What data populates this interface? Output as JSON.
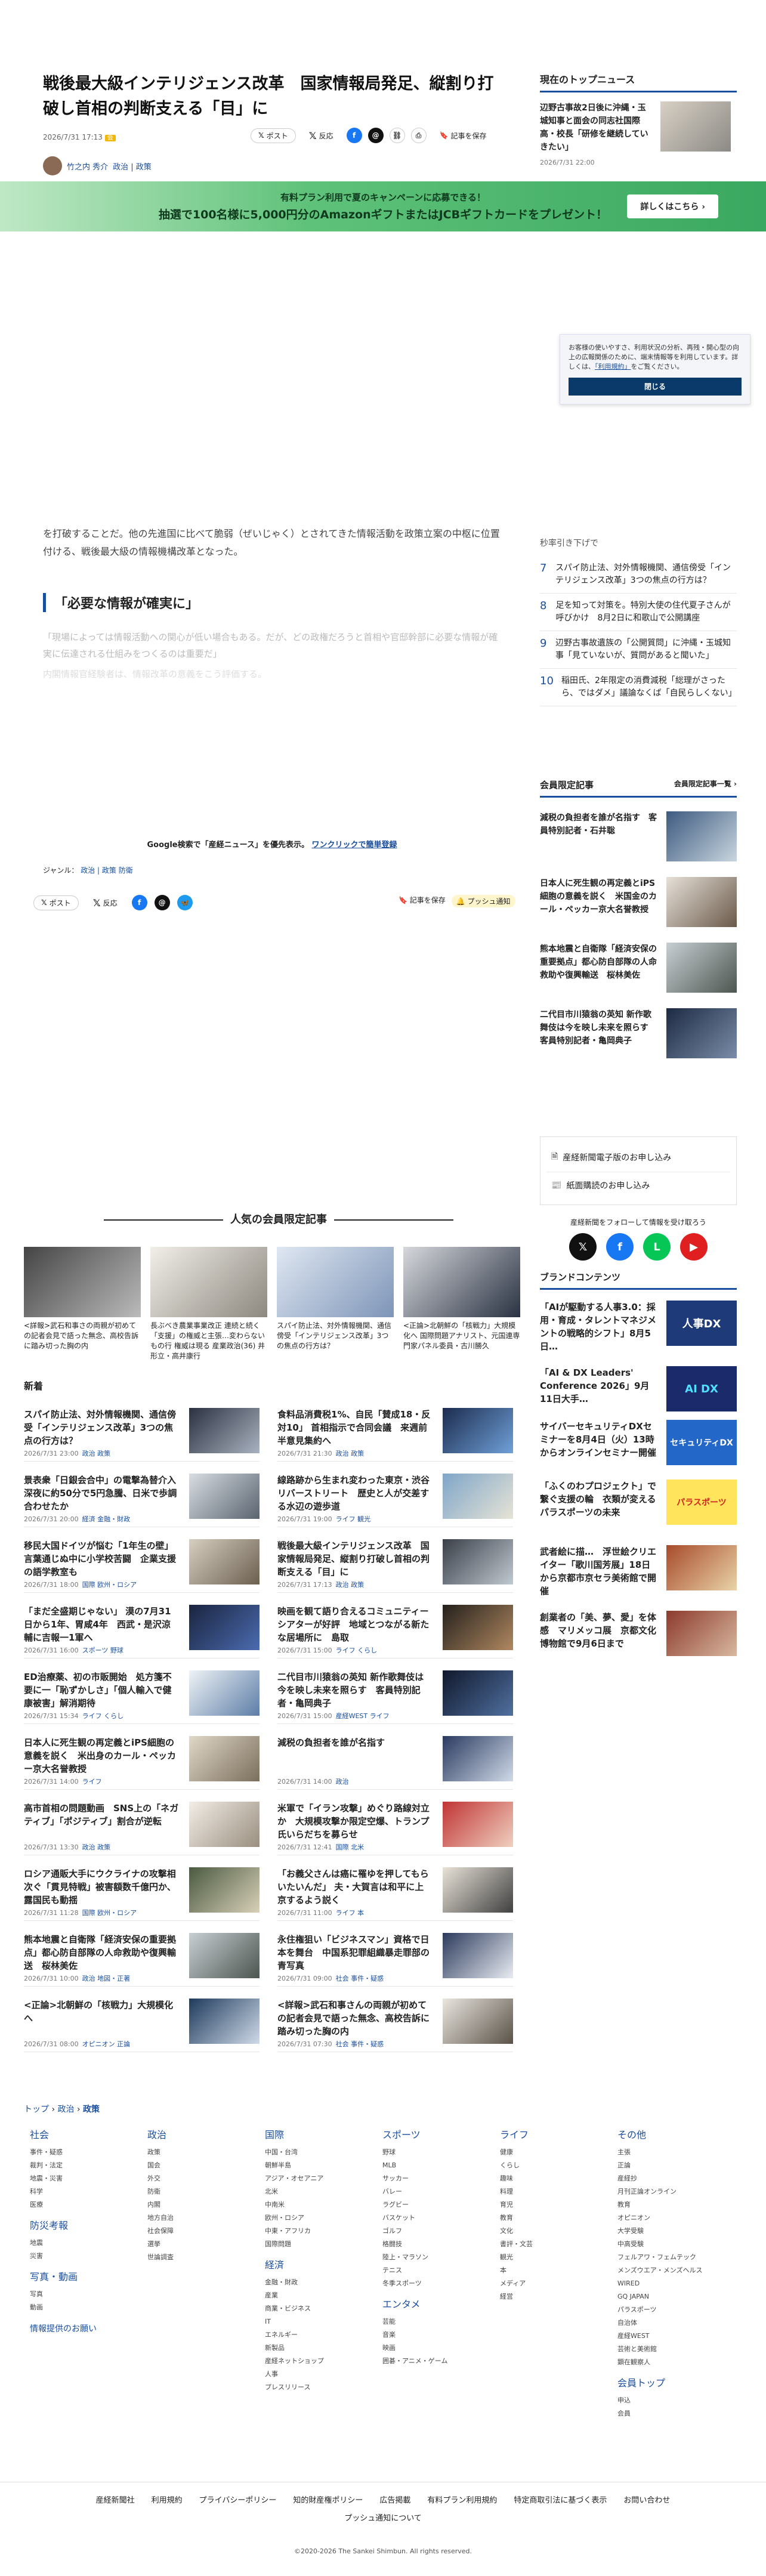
{
  "article": {
    "title": "戦後最大級インテリジェンス改革　国家情報局発足、縦割り打破し首相の判断支える「目」に",
    "date": "2026/7/31 17:13",
    "author": "竹之内 秀介",
    "genre_inline": "政治 | 政策",
    "post_label": "ポスト",
    "repost_label": "反応",
    "save_label": "記事を保存",
    "paragraph_faded": "を打破することだ。他の先進国に比べて脆弱（ぜいじゃく）とされてきた情報活動を政策立案の中枢に位置付ける、戦後最大級の情報機構改革となった。",
    "h2": "「必要な情報が確実に」",
    "paragraph_faded2": "「現場によっては情報活動への関心が低い場合もある。だが、どの政権だろうと首相や官邸幹部に必要な情報が確実に伝達される仕組みをつくるのは重要だ」",
    "paragraph_faded3": "内閣情報官経験者は、情報改革の意義をこう評価する。",
    "google_note": "Google検索で「産経ニュース」を優先表示。",
    "google_link": "ワンクリックで簡単登録",
    "genre_label": "ジャンル：",
    "genre_tags": "政治 | 政策 防衛",
    "push_label": "プッシュ通知"
  },
  "promo": {
    "line1": "有料プラン利用で夏のキャンペーンに応募できる！",
    "line2": "抽選で100名様に5,000円分のAmazonギフトまたはJCBギフトカードをプレゼント！",
    "button": "詳しくはこちら ›"
  },
  "sidebar": {
    "top_heading": "現在のトップニュース",
    "top_title": "辺野古事故2日後に沖縄・玉城知事と面会の同志社国際高・校長「研修を継続していきたい」",
    "top_time": "2026/7/31 22:00",
    "consent_text": "お客様の使いやすさ、利用状況の分析、再残・開心型の向上の広報関係のために、端末情報等を利用しています。詳しくは、",
    "consent_link": "「利用規約」",
    "consent_text2": "をご覧ください。",
    "consent_close": "閉じる",
    "ranking_head": "秒率引き下げで",
    "ranking": [
      {
        "n": "7",
        "t": "スパイ防止法、対外情報機関、通信傍受「インテリジェンス改革」3つの焦点の行方は？"
      },
      {
        "n": "8",
        "t": "足を知って対策を。特別大使の住代夏子さんが呼びかけ　8月2日に和歌山で公開講座"
      },
      {
        "n": "9",
        "t": "辺野古事故遺族の「公開質問」に沖縄・玉城知事「見ていないが、質問があると聞いた」"
      },
      {
        "n": "10",
        "t": "稲田氏、2年限定の消費減税「総理がさったら、ではダメ」議論なくば「自民らしくない」"
      }
    ],
    "member_heading": "会員限定記事",
    "member_more": "会員限定記事一覧 ›",
    "member": [
      "減税の負担者を誰が名指す　客員特別記者・石井聡",
      "日本人に死生観の再定義とiPS細胞の意義を説く　米国金のカール・ペッカー京大名誉教授",
      "熊本地震と自衛隊「経済安保の重要拠点」都心防自部隊の人命救助や復興輸送　桜林美佐",
      "二代目市川猿翁の英知 新作歌舞伎は今を映し未来を照らす　客員特別記者・亀岡典子"
    ],
    "nl1": "産経新聞電子版のお申し込み",
    "nl2": "紙面購読のお申し込み",
    "follow": "産経新聞をフォローして情報を受け取ろう",
    "brand_heading": "ブランドコンテンツ",
    "brand": [
      {
        "t": "「AIが駆動する人事3.0：採用・育成・タレントマネジメントの戦略的シフト」8月5日…",
        "img": "人事DX"
      },
      {
        "t": "「AI & DX Leaders' Conference 2026」9月11日大手…",
        "img": "AI DX"
      },
      {
        "t": "サイバーセキュリティDXセミナーを8月4日（火）13時からオンラインセミナー開催",
        "img": "セキュリティDX"
      },
      {
        "t": "「ふくのわプロジェクト」で繋ぐ支援の輪　衣類が変えるパラスポーツの未来",
        "img": "パラスポーツ"
      },
      {
        "t": "武者絵に描…　浮世絵クリエイター「歌川国芳展」18日から京都市京セラ美術館で開催",
        "img": ""
      },
      {
        "t": "創業者の「美、夢、愛」を体感　マリメッコ展　京都文化博物館で9月6日まで",
        "img": ""
      }
    ]
  },
  "popular": {
    "heading": "人気の会員限定記事",
    "items": [
      "<詳報>武石和事さの両親が初めての記者会見で語った無念、高校告訴に踏み切った胸の内",
      "長ぶべき農業事業改正 連続と続く「支援」の権威と主張…変わらないもの行 権威は現る 産業政治(36) 井形立・高井康行",
      "スパイ防止法、対外情報機関、通信傍受「インテリジェンス改革」3つの焦点の行方は？",
      "<正論>北朝鮮の「核戦力」大規模化へ 国際問題アナリスト、元国連専門家パネル委員・古川勝久"
    ]
  },
  "news": {
    "heading": "新着",
    "items": [
      {
        "t": "スパイ防止法、対外情報機関、通信傍受「インテリジェンス改革」3つの焦点の行方は？",
        "d": "2026/7/31 23:00",
        "c": "政治 政策"
      },
      {
        "t": "食料品消費税1%、自民「賛成18・反対10」 首相指示で合同会議　来週前半意見集約へ",
        "d": "2026/7/31 21:30",
        "c": "政治 政策"
      },
      {
        "t": "景表衆「日銀会合中」の電撃為替介入　深夜に約50分で5円急騰、日米で歩調合わせたか",
        "d": "2026/7/31 20:00",
        "c": "経済 金融・財政"
      },
      {
        "t": "線路跡から生まれ変わった東京・渋谷リバーストリート　歴史と人が交差する水辺の遊歩道",
        "d": "2026/7/31 19:00",
        "c": "ライフ 観光"
      },
      {
        "t": "移民大国ドイツが悩む「1年生の壁」 言葉通じぬ中に小学校苦闘　企業支援の語学教室も",
        "d": "2026/7/31 18:00",
        "c": "国際 欧州・ロシア"
      },
      {
        "t": "戦後最大級インテリジェンス改革　国家情報局発足、縦割り打破し首相の判断支える「目」に",
        "d": "2026/7/31 17:13",
        "c": "政治 政策"
      },
      {
        "t": "「まだ全盛期じゃない」 漠の7月31日から1年、胃咸4年　西武・是沢涼輔に吉報一1軍へ",
        "d": "2026/7/31 16:00",
        "c": "スポーツ 野球"
      },
      {
        "t": "映画を観て語り合えるコミュニティーシアターが好評　地域とつながる新たな居場所に　島取",
        "d": "2026/7/31 15:00",
        "c": "ライフ くらし"
      },
      {
        "t": "ED治療薬、初の市販開始　処方箋不要に一「恥ずかしさ」「個人輸入で健康被害」解消期待",
        "d": "2026/7/31 15:34",
        "c": "ライフ くらし"
      },
      {
        "t": "二代目市川猿翁の英知 新作歌舞伎は今を映し未来を照らす　客員特別記者・亀岡典子",
        "d": "2026/7/31 15:00",
        "c": "産経WEST ライフ"
      },
      {
        "t": "日本人に死生観の再定義とiPS細胞の意義を説く　米出身のカール・ペッカー京大名誉教授",
        "d": "2026/7/31 14:00",
        "c": "ライフ"
      },
      {
        "t": "減税の負担者を誰が名指す",
        "d": "2026/7/31 14:00",
        "c": "政治"
      },
      {
        "t": "高市首相の問題動画　SNS上の「ネガティブ」「ポジティブ」割合が逆転",
        "d": "2026/7/31 13:30",
        "c": "政治 政策"
      },
      {
        "t": "米軍で「イラン攻撃」めぐり路線対立か　大規模攻撃か限定空爆、トランプ氏いらだちを募らせ",
        "d": "2026/7/31 12:41",
        "c": "国際 北米"
      },
      {
        "t": "ロシア通販大手にウクライナの攻撃相次ぐ「貫見特戦」被害額数千億円か、露国民も動揺",
        "d": "2026/7/31 11:28",
        "c": "国際 欧州・ロシア"
      },
      {
        "t": "「お義父さんは癌に罹ゆを押してもらいたいんだ」 夫・大賀言は和平に上京するよう説く",
        "d": "2026/7/31 11:00",
        "c": "ライフ 本"
      },
      {
        "t": "熊本地震と自衛隊「経済安保の重要拠点」都心防自部隊の人命救助や復興輸送　桜林美佐",
        "d": "2026/7/31 10:00",
        "c": "政治 地図・正著"
      },
      {
        "t": "永住権狙い「ビジネスマン」資格で日本を舞台　中国系犯罪組織暴走罪部の青写真",
        "d": "2026/7/31 09:00",
        "c": "社会 事件・疑惑"
      },
      {
        "t": "<正論>北朝鮮の「核戦力」大規模化へ",
        "d": "2026/7/31 08:00",
        "c": "オピニオン 正論"
      },
      {
        "t": "<詳報>武石和事さんの両親が初めての記者会見で語った無念、高校告訴に踏み切った胸の内",
        "d": "2026/7/31 07:30",
        "c": "社会 事件・疑惑"
      }
    ]
  },
  "crumb": {
    "a": "トップ",
    "b": "政治",
    "c": "政策"
  },
  "footer_cols": [
    {
      "h": "社会",
      "items": [
        "事件・疑惑",
        "裁判・法定",
        "地震・災害",
        "科学",
        "医療"
      ],
      "sub": "防災考報",
      "items2": [
        "地震",
        "災害"
      ],
      "sub2": "写真・動画",
      "items3": [
        "写真",
        "動画"
      ],
      "sub3": "情報提供のお願い"
    },
    {
      "h": "政治",
      "items": [
        "政策",
        "国会",
        "外交",
        "防衛",
        "内閣",
        "地方自治",
        "社会保障",
        "選挙",
        "世論調査"
      ]
    },
    {
      "h": "国際",
      "items": [
        "中国・台湾",
        "朝鮮半島",
        "アジア・オセアニア",
        "北米",
        "中南米",
        "欧州・ロシア",
        "中東・アフリカ",
        "国際問題"
      ],
      "sub": "経済",
      "items2": [
        "金融・財政",
        "産業",
        "商業・ビジネス",
        "IT",
        "エネルギー",
        "新製品",
        "産経ネットショップ",
        "人事",
        "プレスリリース"
      ]
    },
    {
      "h": "スポーツ",
      "items": [
        "野球",
        "MLB",
        "サッカー",
        "バレー",
        "ラグビー",
        "バスケット",
        "ゴルフ",
        "格闘技",
        "陸上・マラソン",
        "テニス",
        "冬季スポーツ"
      ],
      "sub": "エンタメ",
      "items2": [
        "芸能",
        "音楽",
        "映画",
        "囲碁・アニメ・ゲーム"
      ]
    },
    {
      "h": "ライフ",
      "items": [
        "健康",
        "くらし",
        "趣味",
        "料理",
        "育児",
        "教育",
        "文化",
        "書評・文芸",
        "観光",
        "本",
        "メディア",
        "経営"
      ]
    },
    {
      "h": "その他",
      "items": [
        "主張",
        "正論",
        "産経抄",
        "月刊正論オンライン",
        "教育",
        "オピニオン",
        "大学受験",
        "中高受験",
        "フェルアワ・フェムテック",
        "メンズウエア・メンズヘルス",
        "WIRED",
        "GQ JAPAN",
        "パラスポーツ",
        "自治体",
        "産経WEST",
        "芸術と美術館",
        "顕在観察人"
      ],
      "sub2": "会員トップ",
      "items3": [
        "申込",
        "会員"
      ]
    }
  ],
  "footer_links": [
    "産経新聞社",
    "利用規約",
    "プライバシーポリシー",
    "知的財産権ポリシー",
    "広告掲載",
    "有料プラン利用規約",
    "特定商取引法に基づく表示",
    "お問い合わせ"
  ],
  "footer_link2": "プッシュ通知について",
  "copyright": "©2020-2026 The Sankei Shimbun. All rights reserved."
}
